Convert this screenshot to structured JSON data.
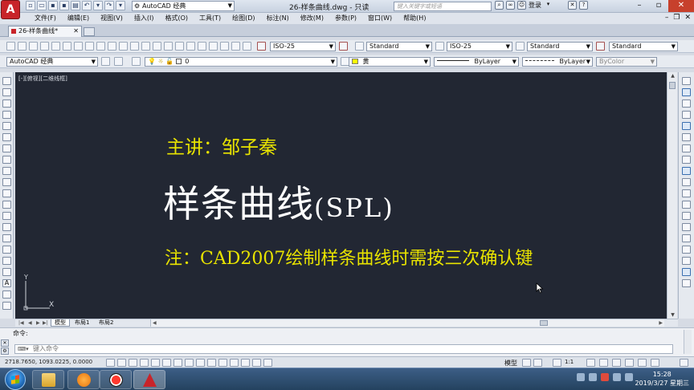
{
  "titlebar": {
    "app_logo": "A",
    "workspace": "AutoCAD 经典",
    "window_title": "26-样条曲线.dwg - 只读",
    "search_placeholder": "键入关键字或短语",
    "login_label": "登录"
  },
  "menu": {
    "items": [
      "文件(F)",
      "编辑(E)",
      "视图(V)",
      "插入(I)",
      "格式(O)",
      "工具(T)",
      "绘图(D)",
      "标注(N)",
      "修改(M)",
      "参数(P)",
      "窗口(W)",
      "帮助(H)"
    ]
  },
  "document_tab": {
    "label": "26-样条曲线*"
  },
  "styles_toolbar": {
    "text_style": "ISO-25",
    "dim_style": "Standard",
    "table_style": "ISO-25",
    "multileader_style": "Standard",
    "extra_style": "Standard"
  },
  "layers_toolbar": {
    "workspace": "AutoCAD 经典",
    "current_layer": "0",
    "color": "黄",
    "color_hex": "#ffff00",
    "linetype": "ByLayer",
    "lineweight": "ByLayer",
    "plot_style": "ByColor"
  },
  "canvas": {
    "viewport_label": "[-][俯视][二维线框]",
    "lecturer": "主讲：邹子秦",
    "title_cn": "样条曲线",
    "title_en": "(SPL)",
    "note": "注：CAD2007绘制样条曲线时需按三次确认键",
    "ucs_y": "Y",
    "ucs_x": "X",
    "text_yellow": "#e8e300",
    "background": "#222733"
  },
  "layout_tabs": [
    "模型",
    "布局1",
    "布局2"
  ],
  "command": {
    "history_label": "命令:",
    "input_placeholder": "键入命令"
  },
  "status": {
    "coordinates": "2718.7650, 1093.0225, 0.0000",
    "model_label": "模型",
    "scale_label": "1:1"
  },
  "taskbar": {
    "time": "15:28",
    "date": "2019/3/27 星期三"
  }
}
